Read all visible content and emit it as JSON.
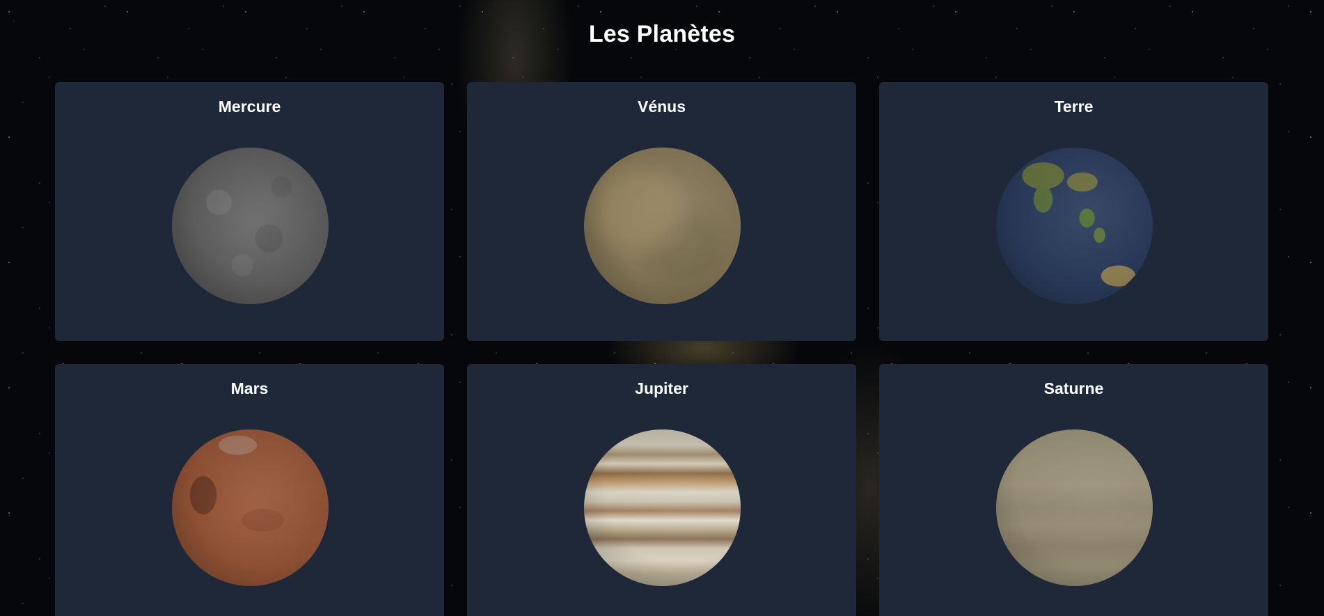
{
  "page": {
    "title": "Les Planètes"
  },
  "planets": [
    {
      "name": "Mercure",
      "texture": "mercury-texture",
      "color": "#5f5f5f"
    },
    {
      "name": "Vénus",
      "texture": "venus-texture",
      "color": "#857858"
    },
    {
      "name": "Terre",
      "texture": "earth-texture",
      "color": "#2a3a58"
    },
    {
      "name": "Mars",
      "texture": "mars-texture",
      "color": "#935437"
    },
    {
      "name": "Jupiter",
      "texture": "jupiter-texture",
      "color": "#c2b7a2"
    },
    {
      "name": "Saturne",
      "texture": "saturn-texture",
      "color": "#928a72"
    }
  ],
  "theme": {
    "card_background": "#1f2839",
    "text_color": "#ffffff",
    "background": "starfield"
  }
}
